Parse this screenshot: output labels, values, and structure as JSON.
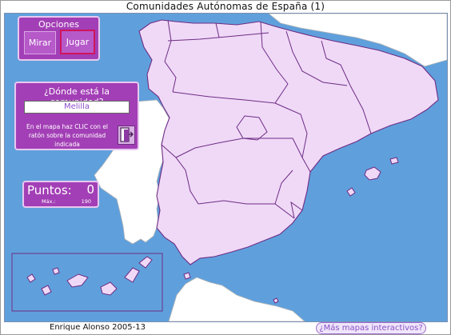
{
  "window": {
    "title": "Comunidades Autónomas de España (1)"
  },
  "options": {
    "label": "Opciones",
    "mirar_label": "Mirar",
    "jugar_label": "Jugar"
  },
  "question": {
    "prompt": "¿Dónde está la comunidad?",
    "answer": "Melilla",
    "instructions": "En el mapa haz CLIC con el ratón sobre la comunidad indicada",
    "exit_icon": "exit-door-icon"
  },
  "score": {
    "label": "Puntos:",
    "value": "0",
    "max_label": "Máx.:",
    "max_value": "190"
  },
  "footer": {
    "author": "Enrique Alonso 2005-13",
    "more_maps_link": "¿Más mapas interactivos?"
  },
  "colors": {
    "sea": "#5fa0dc",
    "spain": "#efd9f7",
    "foreign_land": "#ffffff",
    "panel": "#a33fb6",
    "accent": "#d0145a",
    "border": "#7a2a8a"
  }
}
